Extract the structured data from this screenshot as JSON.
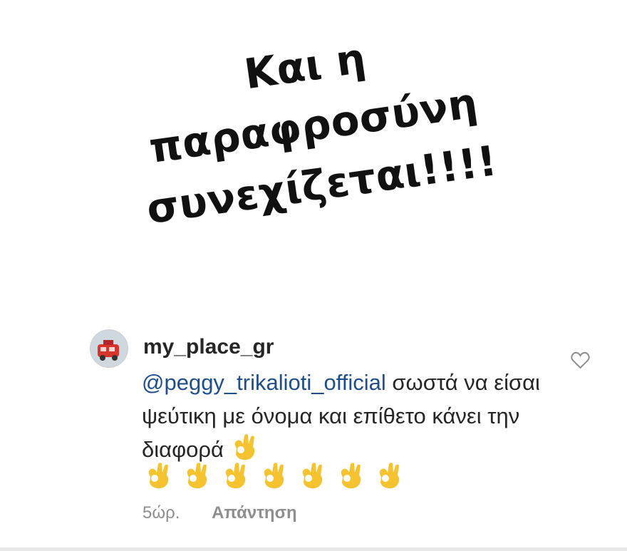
{
  "story": {
    "caption_line1": "Και η παραφροσύνη",
    "caption_line2": "συνεχίζεται!!!!"
  },
  "comment": {
    "username": "my_place_gr",
    "mention": "@peggy_trikalioti_official",
    "text_after_mention": " σωστά να είσαι ψεύτικη με όνομα και επίθετο κάνει την διαφορά",
    "emoji_count_row": 7,
    "time": "5ώρ.",
    "reply_label": "Απάντηση",
    "avatar_icon": "avatar-photo-icon",
    "like_icon": "heart-outline-icon"
  }
}
